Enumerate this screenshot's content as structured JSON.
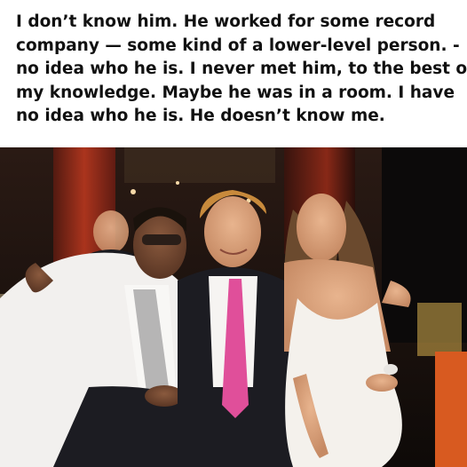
{
  "caption": {
    "lines": [
      "I don’t know him. He worked for some record",
      "company — some kind of a lower-level person. -",
      "no idea who he is. I never met him, to the best of",
      "my knowledge. Maybe he was in a room. I have",
      "no idea who he is. He doesn’t know me."
    ]
  },
  "photo": {
    "description_colors": {
      "background_dark": "#1a1210",
      "curtain_red": "#b8321e",
      "white_suit": "#f2f0ee",
      "dark_suit": "#1c1c22",
      "pink_tie": "#e04f9a",
      "white_dress": "#f4f1ec",
      "hair_blonde": "#c88a3c",
      "hair_brown": "#6b4a2e",
      "skin": "#d9a27f"
    }
  }
}
